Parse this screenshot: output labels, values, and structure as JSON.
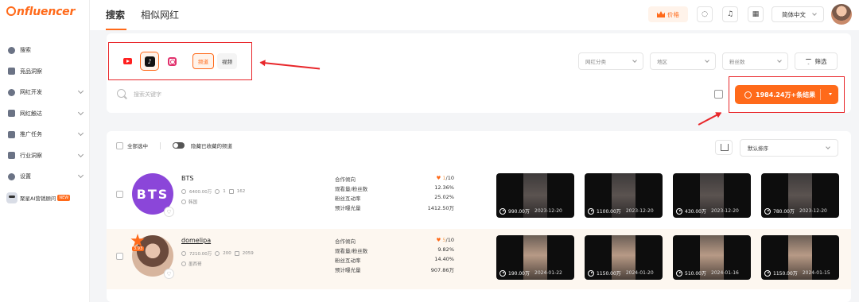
{
  "brand": {
    "logo_text": "nfluencer",
    "accent": "#ff6a1a"
  },
  "sidebar": {
    "items": [
      {
        "label": "搜索",
        "icon": "search-icon",
        "expandable": false
      },
      {
        "label": "竞品洞察",
        "icon": "insight-icon",
        "expandable": false
      },
      {
        "label": "网红开发",
        "icon": "heart-icon",
        "expandable": true
      },
      {
        "label": "网红触达",
        "icon": "mail-icon",
        "expandable": true
      },
      {
        "label": "推广任务",
        "icon": "task-icon",
        "expandable": true
      },
      {
        "label": "行业洞察",
        "icon": "chart-icon",
        "expandable": true
      },
      {
        "label": "设置",
        "icon": "gear-icon",
        "expandable": true
      }
    ],
    "ai_item": {
      "label": "聚星AI营销顾问",
      "badge": "NEW"
    }
  },
  "header": {
    "tabs": [
      {
        "label": "搜索",
        "active": true
      },
      {
        "label": "相似网红",
        "active": false
      }
    ],
    "price_label": "价格",
    "language": "简体中文"
  },
  "search": {
    "platforms": [
      {
        "name": "youtube",
        "selected": false
      },
      {
        "name": "tiktok",
        "selected": true
      },
      {
        "name": "instagram",
        "selected": false
      }
    ],
    "modes": [
      {
        "label": "频道",
        "selected": true
      },
      {
        "label": "视频",
        "selected": false
      }
    ],
    "filters": [
      "网红分类",
      "地区",
      "粉丝数"
    ],
    "filter_button": "筛选",
    "placeholder": "搜索关键字",
    "result_button": "1984.24万+条结果"
  },
  "results": {
    "select_all": "全部选中",
    "hide_collected": "隐藏已收藏的频道",
    "sort": "默认排序",
    "metric_labels": [
      "合作倾向",
      "观看量/粉丝数",
      "粉丝互动率",
      "预计曝光量"
    ],
    "influencers": [
      {
        "name": "BTS",
        "avatar_text": "BTS",
        "fans": "6400.00万",
        "following": "1",
        "videos": "162",
        "location": "韩国",
        "coop_score": "1",
        "coop_max": "/10",
        "view_ratio": "12.36%",
        "engagement": "25.02%",
        "exposure": "1412.50万",
        "videos_list": [
          {
            "views": "990.00万",
            "date": "2023-12-20"
          },
          {
            "views": "1100.00万",
            "date": "2023-12-20"
          },
          {
            "views": "430.00万",
            "date": "2023-12-20"
          },
          {
            "views": "780.00万",
            "date": "2023-12-20"
          }
        ]
      },
      {
        "name": "domelipa",
        "rating": "3.93",
        "fans": "7210.00万",
        "following": "200",
        "videos": "2059",
        "location": "墨西哥",
        "coop_score": "5",
        "coop_max": "/10",
        "view_ratio": "9.82%",
        "engagement": "14.40%",
        "exposure": "907.86万",
        "videos_list": [
          {
            "views": "190.00万",
            "date": "2024-01-22"
          },
          {
            "views": "1150.00万",
            "date": "2024-01-20"
          },
          {
            "views": "510.00万",
            "date": "2024-01-16"
          },
          {
            "views": "1150.00万",
            "date": "2024-01-15"
          }
        ]
      }
    ]
  }
}
